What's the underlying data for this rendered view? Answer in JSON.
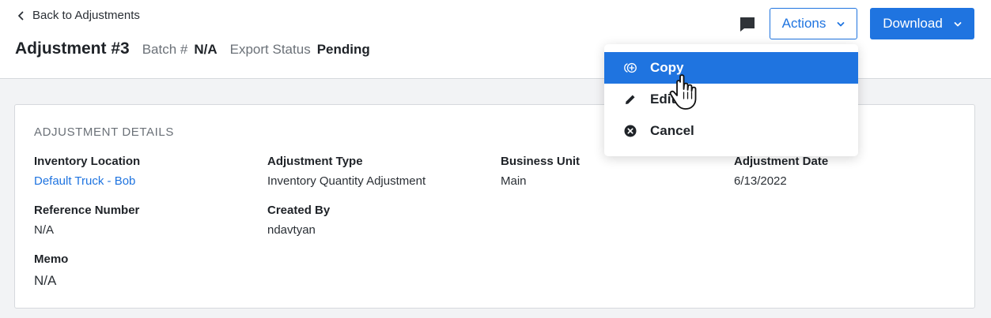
{
  "header": {
    "back_label": "Back to Adjustments",
    "title": "Adjustment #3",
    "batch_label": "Batch #",
    "batch_value": "N/A",
    "export_label": "Export Status",
    "export_value": "Pending",
    "actions_label": "Actions",
    "download_label": "Download"
  },
  "menu": {
    "items": [
      {
        "label": "Copy",
        "icon": "copy-icon",
        "highlighted": true
      },
      {
        "label": "Edit",
        "icon": "pencil-icon",
        "highlighted": false
      },
      {
        "label": "Cancel",
        "icon": "cancel-circle-icon",
        "highlighted": false
      }
    ]
  },
  "details": {
    "section_title": "ADJUSTMENT DETAILS",
    "inventory_location": {
      "label": "Inventory Location",
      "value": "Default Truck - Bob"
    },
    "adjustment_type": {
      "label": "Adjustment Type",
      "value": "Inventory Quantity Adjustment"
    },
    "business_unit": {
      "label": "Business Unit",
      "value": "Main"
    },
    "adjustment_date": {
      "label": "Adjustment Date",
      "value": "6/13/2022"
    },
    "reference_number": {
      "label": "Reference Number",
      "value": "N/A"
    },
    "created_by": {
      "label": "Created By",
      "value": "ndavtyan"
    },
    "memo": {
      "label": "Memo",
      "value": "N/A"
    }
  },
  "colors": {
    "accent": "#1f74e0",
    "background": "#f2f3f5",
    "card": "#ffffff"
  }
}
